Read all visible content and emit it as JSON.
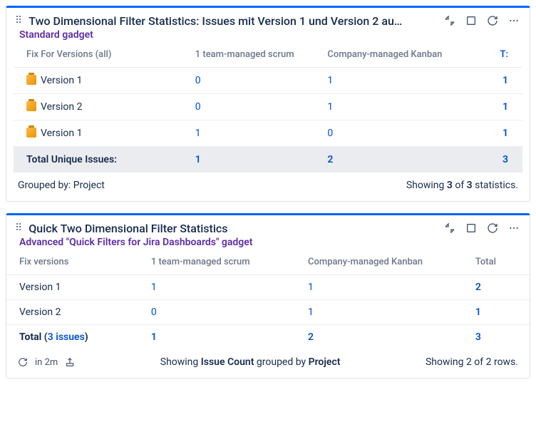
{
  "gadget1": {
    "title": "Two Dimensional Filter Statistics: Issues mit Version 1 und Version 2 au…",
    "subtitle": "Standard gadget",
    "columns": {
      "c0": "Fix For Versions (all)",
      "c1": "1 team-managed scrum",
      "c2": "Company-managed Kanban",
      "c3": "T:"
    },
    "rows": {
      "r0": {
        "label": "Version 1",
        "v1": "0",
        "v2": "1",
        "t": "1"
      },
      "r1": {
        "label": "Version 2",
        "v1": "0",
        "v2": "1",
        "t": "1"
      },
      "r2": {
        "label": "Version 1",
        "v1": "1",
        "v2": "0",
        "t": "1"
      }
    },
    "totalRow": {
      "label": "Total Unique Issues:",
      "v1": "1",
      "v2": "2",
      "t": "3"
    },
    "footerLeft": "Grouped by: Project",
    "footerRight_a": "Showing ",
    "footerRight_b": "3",
    "footerRight_c": " of ",
    "footerRight_d": "3",
    "footerRight_e": " statistics."
  },
  "gadget2": {
    "title": "Quick Two Dimensional Filter Statistics",
    "subtitle": "Advanced \"Quick Filters for Jira Dashboards\" gadget",
    "columns": {
      "c0": "Fix versions",
      "c1": "1 team-managed scrum",
      "c2": "Company-managed Kanban",
      "c3": "Total"
    },
    "rows": {
      "r0": {
        "label": "Version 1",
        "v1": "1",
        "v2": "1",
        "t": "2"
      },
      "r1": {
        "label": "Version 2",
        "v1": "0",
        "v2": "1",
        "t": "1"
      }
    },
    "totalRow": {
      "label_a": "Total (",
      "label_b": "3 issues",
      "label_c": ")",
      "v1": "1",
      "v2": "2",
      "t": "3"
    },
    "refreshIn": "in 2m",
    "footerCenter_a": "Showing ",
    "footerCenter_b": "Issue Count",
    "footerCenter_c": " grouped by ",
    "footerCenter_d": "Project",
    "footerRight": "Showing 2 of 2 rows."
  }
}
